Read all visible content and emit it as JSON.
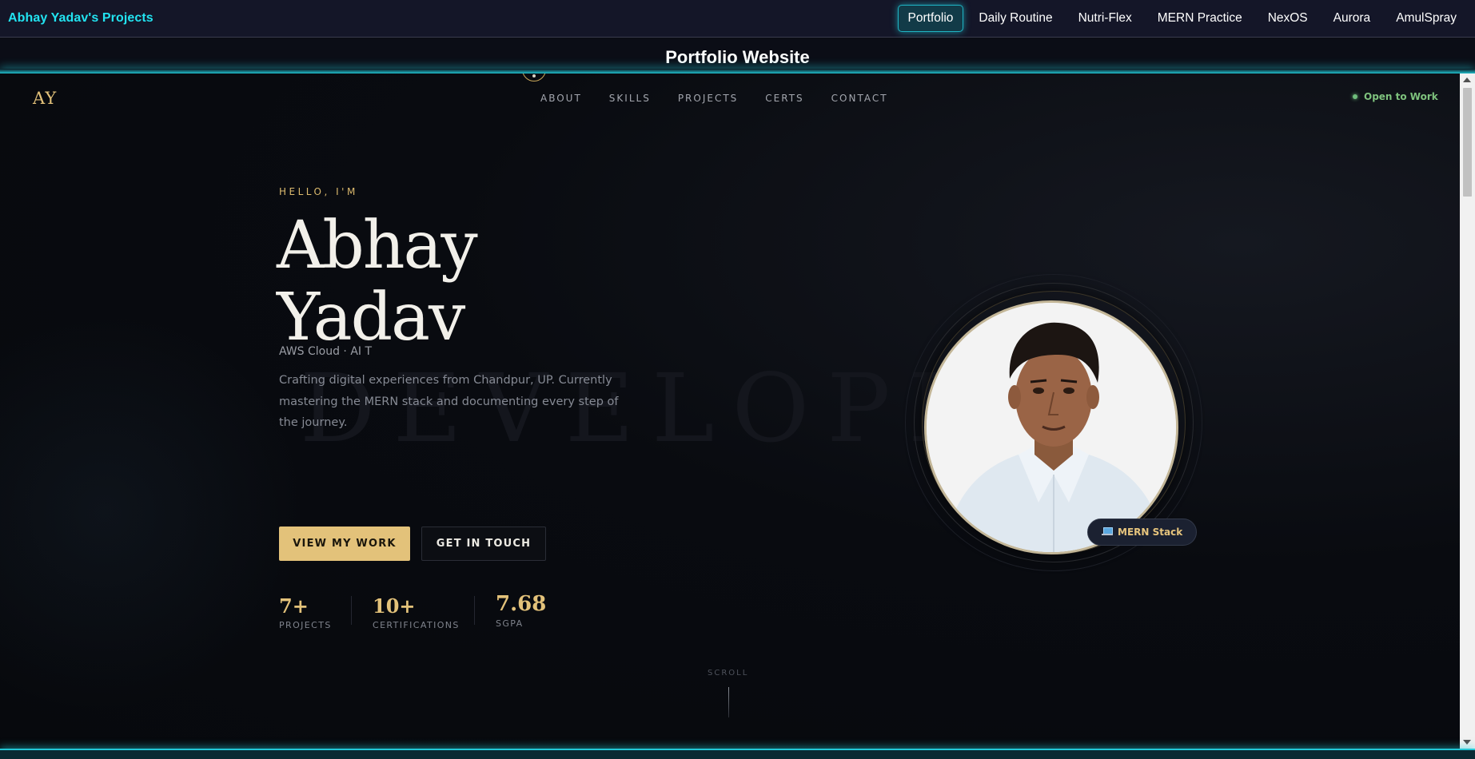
{
  "viewer": {
    "brand": "Abhay Yadav's Projects",
    "tabs": [
      {
        "label": "Portfolio",
        "active": true
      },
      {
        "label": "Daily Routine",
        "active": false
      },
      {
        "label": "Nutri-Flex",
        "active": false
      },
      {
        "label": "MERN Practice",
        "active": false
      },
      {
        "label": "NexOS",
        "active": false
      },
      {
        "label": "Aurora",
        "active": false
      },
      {
        "label": "AmulSpray",
        "active": false
      }
    ],
    "title": "Portfolio Website",
    "accent": "#22e3f0"
  },
  "site": {
    "logo": "AY",
    "nav": [
      "ABOUT",
      "SKILLS",
      "PROJECTS",
      "CERTS",
      "CONTACT"
    ],
    "status": "Open to Work",
    "background_word": "DEVELOPER",
    "hero": {
      "greeting": "HELLO, I'M",
      "first_name": "Abhay",
      "last_name": "Yadav",
      "role": "AWS Cloud · AI T",
      "bio": "Crafting digital experiences from Chandpur, UP. Currently mastering the MERN stack and documenting every step of the journey.",
      "primary_button": "VIEW MY WORK",
      "secondary_button": "GET IN TOUCH"
    },
    "stats": [
      {
        "value": "7+",
        "label": "PROJECTS"
      },
      {
        "value": "10+",
        "label": "CERTIFICATIONS"
      },
      {
        "value": "7.68",
        "label": "SGPA"
      }
    ],
    "scroll_label": "SCROLL",
    "profile_badge": "MERN Stack",
    "colors": {
      "gold": "#e3c27a",
      "status_green": "#7ec27d",
      "background": "#090b10"
    }
  }
}
